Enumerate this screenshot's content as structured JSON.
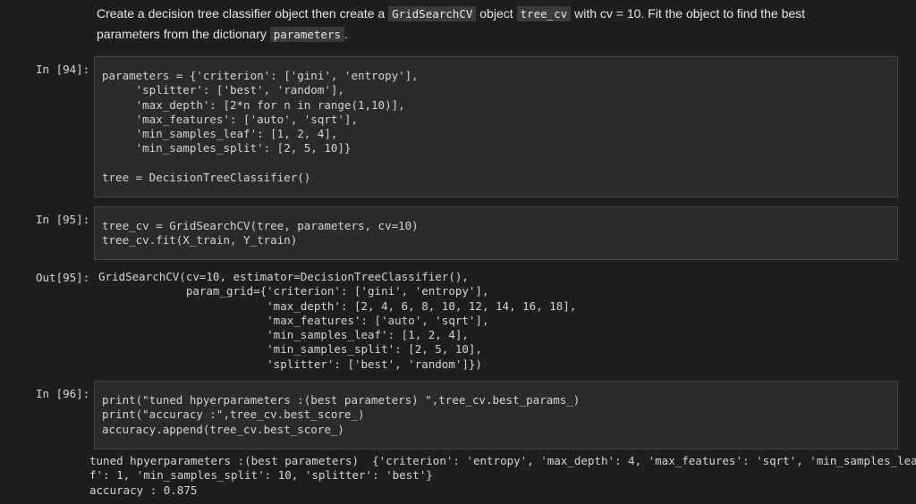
{
  "markdown": {
    "t1": "Create a decision tree classifier object then create a ",
    "c1": "GridSearchCV",
    "t2": " object ",
    "c2": "tree_cv",
    "t3": " with cv = 10. Fit the object to find the best parameters from the dictionary ",
    "c3": "parameters",
    "t4": "."
  },
  "cells": [
    {
      "prompt": "In [94]:",
      "code": [
        "parameters = {'criterion': ['gini', 'entropy'],",
        "     'splitter': ['best', 'random'],",
        "     'max_depth': [2*n for n in range(1,10)],",
        "     'max_features': ['auto', 'sqrt'],",
        "     'min_samples_leaf': [1, 2, 4],",
        "     'min_samples_split': [2, 5, 10]}",
        "",
        "tree = DecisionTreeClassifier()"
      ]
    },
    {
      "prompt": "In [95]:",
      "code": [
        "tree_cv = GridSearchCV(tree, parameters, cv=10)",
        "tree_cv.fit(X_train, Y_train)"
      ],
      "out_prompt": "Out[95]:",
      "output": [
        "GridSearchCV(cv=10, estimator=DecisionTreeClassifier(),",
        "             param_grid={'criterion': ['gini', 'entropy'],",
        "                         'max_depth': [2, 4, 6, 8, 10, 12, 14, 16, 18],",
        "                         'max_features': ['auto', 'sqrt'],",
        "                         'min_samples_leaf': [1, 2, 4],",
        "                         'min_samples_split': [2, 5, 10],",
        "                         'splitter': ['best', 'random']})"
      ]
    },
    {
      "prompt": "In [96]:",
      "code": [
        "print(\"tuned hpyerparameters :(best parameters) \",tree_cv.best_params_)",
        "print(\"accuracy :\",tree_cv.best_score_)",
        "accuracy.append(tree_cv.best_score_)"
      ],
      "output": [
        "tuned hpyerparameters :(best parameters)  {'criterion': 'entropy', 'max_depth': 4, 'max_features': 'sqrt', 'min_samples_lea",
        "f': 1, 'min_samples_split': 10, 'splitter': 'best'}",
        "accuracy : 0.875"
      ]
    }
  ]
}
